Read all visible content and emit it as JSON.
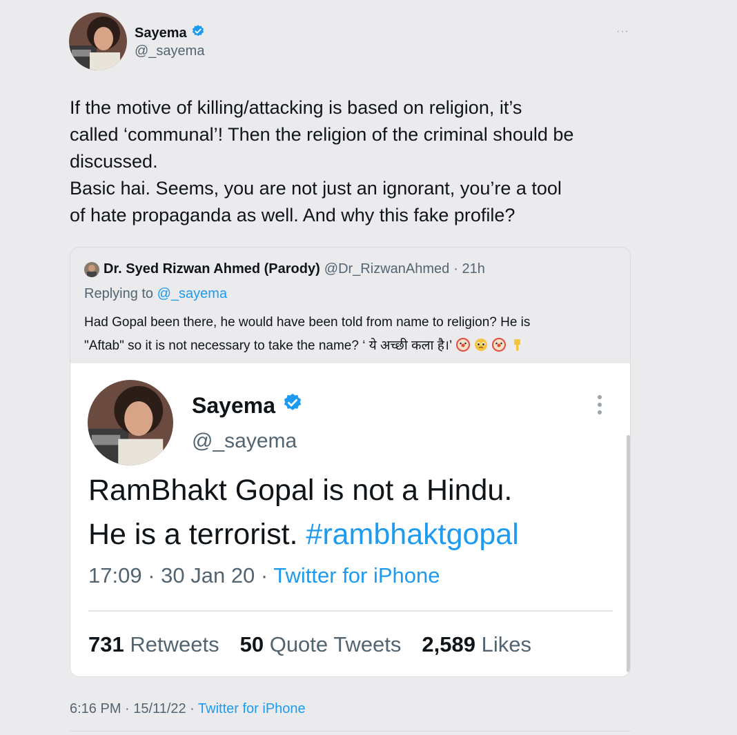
{
  "tweet": {
    "author_name": "Sayema",
    "author_handle": "@_sayema",
    "more_label": "···",
    "body_lines": [
      "If the motive of killing/attacking is based on religion, it’s",
      "called ‘communal’! Then the religion of the criminal should be",
      "discussed.",
      "Basic hai. Seems, you are not just an ignorant, you’re a tool",
      "of hate propaganda as well. And why this fake profile?"
    ],
    "time": "6:16 PM · 15/11/22 · ",
    "source": "Twitter for iPhone"
  },
  "quote": {
    "author_name": "Dr. Syed Rizwan Ahmed (Parody)",
    "author_handle": "@Dr_RizwanAhmed",
    "age": " · 21h",
    "replying_prefix": "Replying to ",
    "replying_to": "@_sayema",
    "text_line1": "Had Gopal been there, he would have been told from name to religion? He is",
    "text_line2": "\"Aftab\" so it is not necessary to take the name? ‘ ये अच्छी कला है।’ ",
    "emojis": [
      "clown-face-emoji",
      "pleading-face-emoji",
      "clown-face-emoji",
      "pointing-down-emoji"
    ]
  },
  "screenshot": {
    "author_name": "Sayema",
    "author_handle": "@_sayema",
    "text_line1": "RamBhakt Gopal is not a Hindu.",
    "text_line2_plain": "He is a terrorist. ",
    "hashtag": "#rambhaktgopal",
    "time": "17:09 · 30 Jan 20 · ",
    "source": "Twitter for iPhone",
    "retweets_count": "731",
    "retweets_label": "Retweets",
    "quotes_count": "50",
    "quotes_label": "Quote Tweets",
    "likes_count": "2,589",
    "likes_label": "Likes"
  },
  "colors": {
    "background": "#ebebed",
    "link_blue": "#1d9bf0",
    "secondary_text": "#536471",
    "verified_blue": "#1d9bf0"
  }
}
